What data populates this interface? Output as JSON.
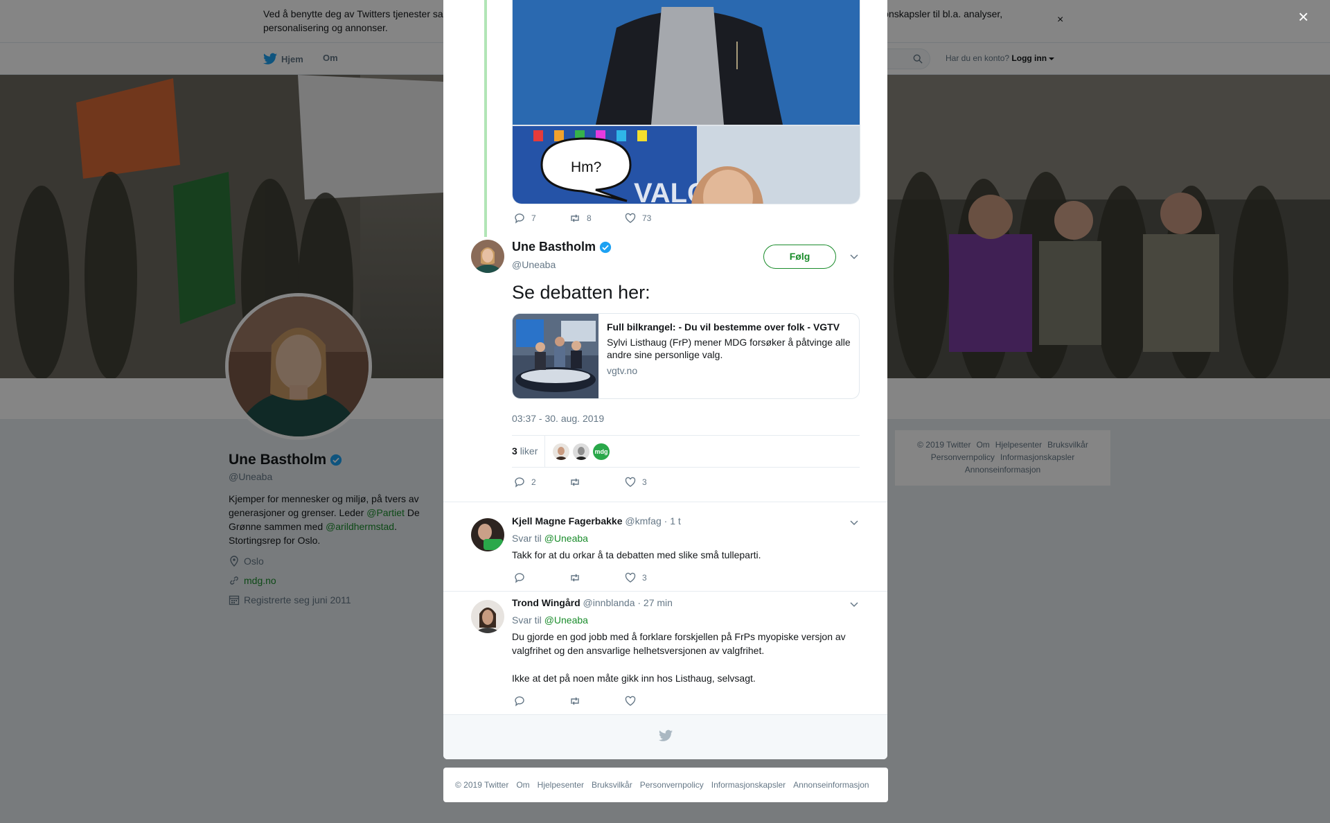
{
  "cookie": {
    "text": "Ved å benytte deg av Twitters tjenester samtykker du til vår bruk av informasjonskapsler. Vi og våre partnere opererer globalt og bruker informasjonskapsler til bl.a. analyser, personalisering og annonser.",
    "close": "×"
  },
  "nav": {
    "home": "Hjem",
    "about": "Om",
    "account_prompt": "Har du en konto?",
    "login": "Logg inn"
  },
  "profile": {
    "name": "Une Bastholm",
    "handle": "@Uneaba",
    "bio_1": "Kjemper for mennesker og miljø, på tvers av generasjoner og grenser. Leder ",
    "bio_link1": "@Partiet",
    "bio_2": " De Grønne sammen med ",
    "bio_link2": "@arildhermstad",
    "bio_3": ". Stortingsrep for Oslo.",
    "location": "Oslo",
    "website": "mdg.no",
    "joined": "Registrerte seg juni 2011"
  },
  "side_footer": [
    "© 2019 Twitter",
    "Om",
    "Hjelpesenter",
    "Bruksvilkår",
    "Personvernpolicy",
    "Informasjonskapsler",
    "Annonseinformasjon"
  ],
  "modal": {
    "close": "×",
    "prev_tweet": {
      "bubble_text": "Hm?",
      "replies": "7",
      "retweets": "8",
      "likes": "73"
    },
    "main_tweet": {
      "name": "Une Bastholm",
      "handle": "@Uneaba",
      "follow": "Følg",
      "text": "Se debatten her:",
      "card": {
        "title": "Full bilkrangel: - Du vil bestemme over folk - VGTV",
        "description": "Sylvi Listhaug (FrP) mener MDG forsøker å påtvinge alle andre sine personlige valg.",
        "domain": "vgtv.no"
      },
      "timestamp": "03:37 - 30. aug. 2019",
      "likes_count": "3",
      "likes_label": "liker",
      "liker_badge": "mdg",
      "replies": "2",
      "retweets": "",
      "likes": "3"
    },
    "replies": [
      {
        "name": "Kjell Magne Fagerbakke",
        "handle": "@kmfag",
        "time": "· 1 t",
        "reply_to_label": "Svar til",
        "reply_to": "@Uneaba",
        "text": "Takk for at du orkar å ta debatten med slike små tulleparti.",
        "likes": "3"
      },
      {
        "name": "Trond Wingård",
        "handle": "@innblanda",
        "time": "· 27 min",
        "reply_to_label": "Svar til",
        "reply_to": "@Uneaba",
        "text_1": "Du gjorde en god jobb med å forklare forskjellen på FrPs myopiske versjon av valgfrihet og den ansvarlige helhetsversjonen av valgfrihet.",
        "text_2": "Ikke at det på noen måte gikk inn hos Listhaug, selvsagt."
      }
    ]
  },
  "bottom_footer": [
    "© 2019 Twitter",
    "Om",
    "Hjelpesenter",
    "Bruksvilkår",
    "Personvernpolicy",
    "Informasjonskapsler",
    "Annonseinformasjon"
  ],
  "colors": {
    "accent": "#1a8c2b",
    "verified": "#1da1f2",
    "thread_line": "#b1e5b6"
  }
}
